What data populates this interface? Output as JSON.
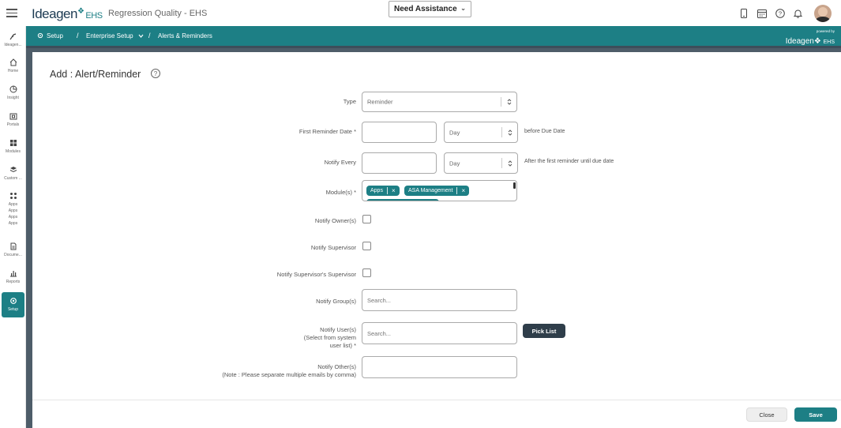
{
  "header": {
    "logo_text": "Ideagen",
    "logo_suffix": "EHS",
    "app_title": "Regression Quality - EHS",
    "assistance_select": "Need Assistance",
    "icons": [
      "mobile-icon",
      "calendar-icon",
      "help-icon",
      "bell-icon",
      "avatar"
    ]
  },
  "sidebar": {
    "items": [
      {
        "label": "Ideagen...",
        "icon": "ideagen-icon"
      },
      {
        "label": "Home",
        "icon": "home-icon"
      },
      {
        "label": "Insight",
        "icon": "insight-icon"
      },
      {
        "label": "Portals",
        "icon": "portals-icon"
      },
      {
        "label": "Modules",
        "icon": "modules-icon"
      },
      {
        "label": "Custom ...",
        "icon": "custom-icon"
      },
      {
        "label": "Apps",
        "icon": "apps-icon"
      },
      {
        "label": "Apps",
        "icon": ""
      },
      {
        "label": "Apps",
        "icon": ""
      },
      {
        "label": "Apps",
        "icon": ""
      },
      {
        "label": "Docume...",
        "icon": "document-icon"
      },
      {
        "label": "Reports",
        "icon": "reports-icon"
      },
      {
        "label": "Setup",
        "icon": "setup-icon",
        "active": true
      }
    ]
  },
  "breadcrumb": {
    "setup": "Setup",
    "enterprise": "Enterprise Setup",
    "current": "Alerts & Reminders",
    "sep": "/",
    "powered_small": "powered by",
    "powered_brand": "Ideagen",
    "powered_suffix": "EHS"
  },
  "form": {
    "title": "Add : Alert/Reminder",
    "help_symbol": "?",
    "type_label": "Type",
    "type_value": "Reminder",
    "first_reminder_label": "First Reminder Date",
    "required_mark": "*",
    "first_reminder_value": "",
    "first_reminder_unit": "Day",
    "first_reminder_hint": "before Due Date",
    "notify_every_label": "Notify Every",
    "notify_every_value": "",
    "notify_every_unit": "Day",
    "notify_every_hint": "After the first reminder until due date",
    "modules_label": "Module(s)",
    "modules_tags": [
      "Apps",
      "ASA Management"
    ],
    "tag_remove": "×",
    "notify_owner_label": "Notify Owner(s)",
    "notify_owner_checked": false,
    "notify_supervisor_label": "Notify Supervisor",
    "notify_supervisor_checked": false,
    "notify_supervisor_supervisor_label": "Notify Supervisor's Supervisor",
    "notify_supervisor_supervisor_checked": false,
    "notify_groups_label": "Notify Group(s)",
    "notify_groups_placeholder": "Search...",
    "notify_users_label_1": "Notify User(s)",
    "notify_users_label_2": "(Select from system",
    "notify_users_label_3": "user list)",
    "notify_users_placeholder": "Search...",
    "pick_list_label": "Pick List",
    "notify_others_label_1": "Notify Other(s)",
    "notify_others_label_2": "(Note : Please separate multiple emails by comma)",
    "notify_others_value": ""
  },
  "footer": {
    "close_label": "Close",
    "save_label": "Save"
  },
  "colors": {
    "accent": "#1d7f85",
    "dark": "#2f3e4a",
    "content_bg": "#4e5d69"
  }
}
